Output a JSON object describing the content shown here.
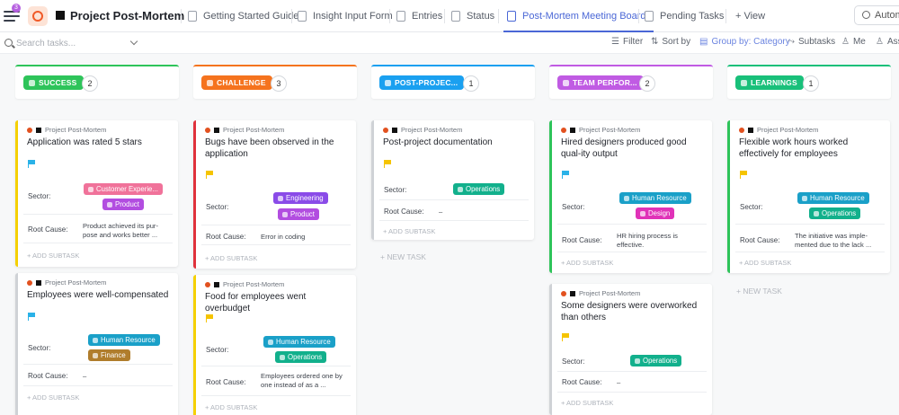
{
  "header": {
    "notif_count": "3",
    "title": "Project Post-Mortem",
    "tabs": [
      {
        "label": "Getting Started Guide"
      },
      {
        "label": "Insight Input Form"
      },
      {
        "label": "Entries"
      },
      {
        "label": "Status"
      },
      {
        "label": "Post-Mortem Meeting Board"
      },
      {
        "label": "Pending Tasks"
      }
    ],
    "add_view": "+ View",
    "automate": "Autom"
  },
  "toolbar": {
    "search_placeholder": "Search tasks...",
    "filter": "Filter",
    "sort_by": "Sort by",
    "group_by": "Group by: Category",
    "subtasks": "Subtasks",
    "me": "Me",
    "assignees": "Assi"
  },
  "labels": {
    "sector": "Sector:",
    "root_cause": "Root Cause:",
    "add_subtask": "+ ADD SUBTASK",
    "new_task": "+ NEW TASK",
    "breadcrumb": "Project Post-Mortem"
  },
  "colors": {
    "success": "#2ec45a",
    "challenge": "#f5731e",
    "post_project": "#1aa0f0",
    "team_performance": "#c05be3",
    "learnings": "#19c07a",
    "flag_cyan": "#2ab2e8",
    "flag_yellow": "#f5c400"
  },
  "columns": [
    {
      "name": "SUCCESS",
      "count": "2"
    },
    {
      "name": "CHALLENGE",
      "count": "3"
    },
    {
      "name": "POST-PROJEC...",
      "count": "1"
    },
    {
      "name": "TEAM PERFOR...",
      "count": "2"
    },
    {
      "name": "LEARNINGS",
      "count": "1"
    }
  ],
  "cards": {
    "c1": {
      "title": "Application was rated 5 stars",
      "tags": [
        "Customer Experie...",
        "Product"
      ],
      "root_cause": "Product achieved its pur-\npose and works better ..."
    },
    "c2": {
      "title": "Employees were well-compensated",
      "tags": [
        "Human Resource",
        "Finance"
      ],
      "root_cause": "–"
    },
    "c3": {
      "title": "Bugs have been observed in the application",
      "tags": [
        "Engineering",
        "Product"
      ],
      "root_cause": "Error in coding"
    },
    "c4": {
      "title": "Food for employees went overbudget",
      "tags": [
        "Human Resource",
        "Operations"
      ],
      "root_cause": "Employees ordered one by one instead of as a ..."
    },
    "c5": {
      "title": "Post-project documentation",
      "tags": [
        "Operations"
      ],
      "root_cause": "–"
    },
    "c6": {
      "title": "Hired designers produced good qual-ity output",
      "tags": [
        "Human Resource",
        "Design"
      ],
      "root_cause": "HR hiring process is effective."
    },
    "c7": {
      "title": "Some designers were overworked than others",
      "tags": [
        "Operations"
      ],
      "root_cause": "–"
    },
    "c8": {
      "title": "Flexible work hours worked effectively for employees",
      "tags": [
        "Human Resource",
        "Operations"
      ],
      "root_cause": "The initiative was imple-\nmented due to the lack ..."
    }
  }
}
